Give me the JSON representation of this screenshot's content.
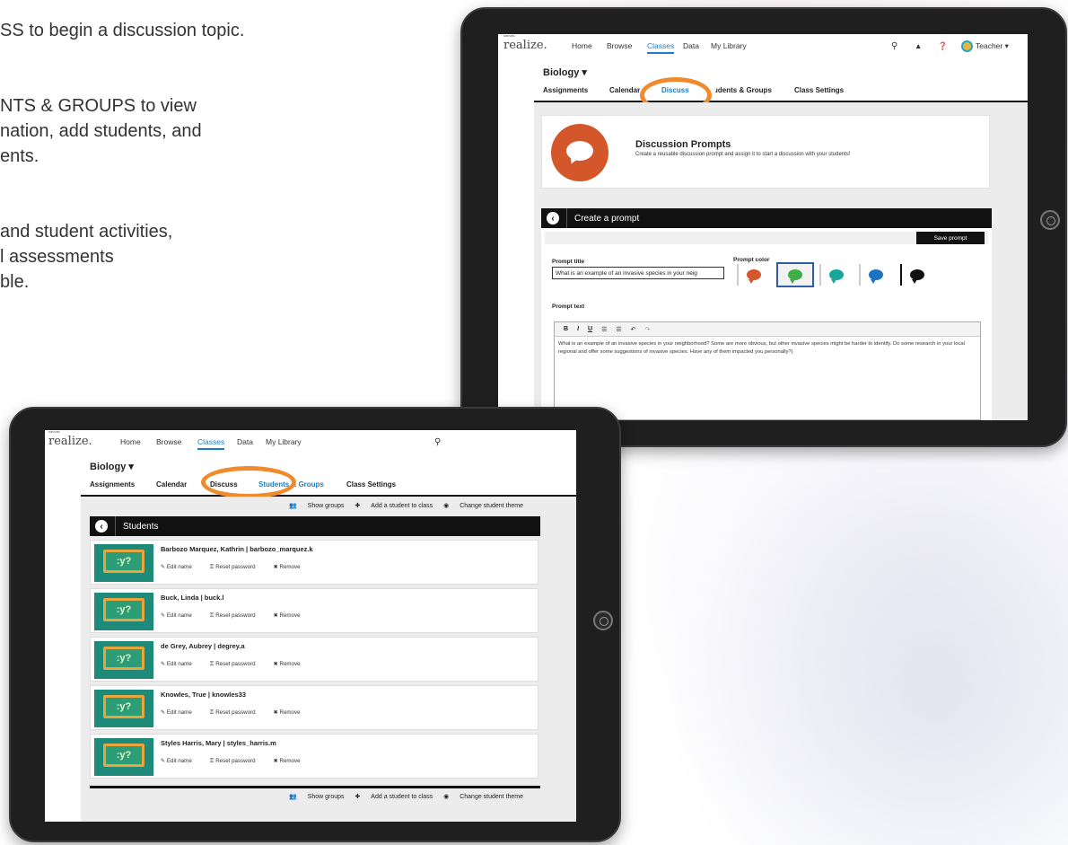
{
  "intro_lines": [
    "SS to begin a discussion topic.",
    "NTS & GROUPS to view",
    "nation, add students, and",
    "ents.",
    "and student activities,",
    "l assessments",
    "ble."
  ],
  "nav": {
    "logo": "realize.",
    "logo_small": "savvas",
    "home": "Home",
    "browse": "Browse",
    "classes": "Classes",
    "data": "Data",
    "library": "My Library",
    "teacher": "Teacher ▾"
  },
  "class_title": "Biology ▾",
  "tabs": {
    "assignments": "Assignments",
    "calendar": "Calendar",
    "discuss": "Discuss",
    "students_groups": "Students & Groups",
    "class_settings": "Class Settings"
  },
  "discuss": {
    "prompts_title": "Discussion Prompts",
    "prompts_desc": "Create a reusable discussion prompt and assign it to start a discussion with your students!",
    "create_title": "Create a prompt",
    "save_label": "Save prompt",
    "prompt_title_label": "Prompt title",
    "prompt_title_value": "What is an example of an invasive species in your neig",
    "prompt_color_label": "Prompt color",
    "prompt_text_label": "Prompt text",
    "prompt_text": "What is an example of an invasive species in your neighborhood? Some are more obvious, but other invasive species might be harder to identify. Do some research in your local regional and offer some suggestions of invasive species. Have any of them impacted you personally?|",
    "colors": [
      "#d4572b",
      "#3fae49",
      "#1aa69a",
      "#1b74c1",
      "#111111"
    ]
  },
  "students": {
    "section_title": "Students",
    "show_groups": "Show groups",
    "add_student": "Add a student to class",
    "change_theme": "Change student theme",
    "edit_name": "Edit name",
    "reset_password": "Reset password",
    "remove": "Remove",
    "list": [
      "Barbozo Marquez, Kathrin | barbozo_marquez.k",
      "Buck, Linda | buck.l",
      "de Grey, Aubrey | degrey.a",
      "Knowles, True | knowles33",
      "Styles Harris, Mary | styles_harris.m"
    ]
  }
}
